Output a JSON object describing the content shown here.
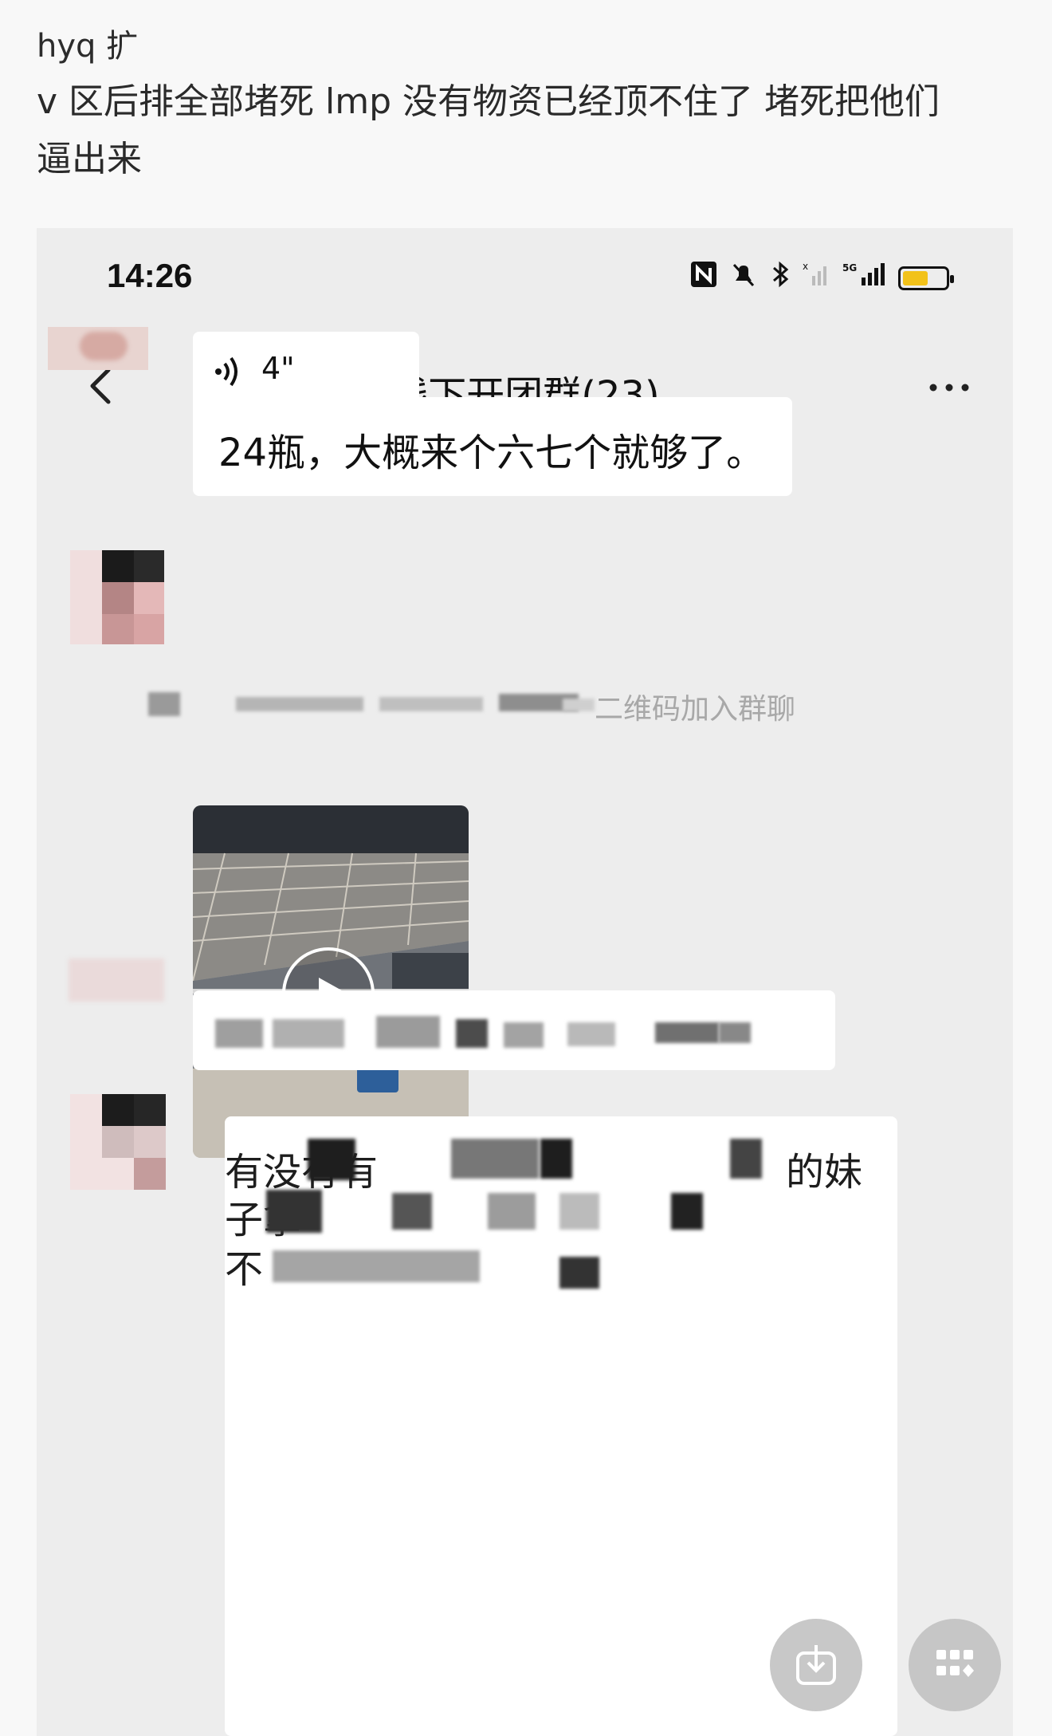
{
  "post": {
    "author": "hyq 扩",
    "text_line1": "v 区后排全部堵死  lmp 没有物资已经顶不住了  堵死把他们",
    "text_line2": "逼出来"
  },
  "phone": {
    "status_time": "14:26",
    "network_label": "5G",
    "battery_level": 0.6,
    "battery_color": "#f2c21a",
    "chat_title": "线下开团群(23)",
    "messages": {
      "voice_duration": "4\"",
      "text_1": "24瓶，大概来个六七个就够了。",
      "system_note": "二维码加入群聊",
      "reply_partial_line1_a": "有没有有",
      "reply_partial_line1_b": "的妹",
      "reply_partial_line2": "子拿",
      "reply_partial_line3": "不"
    }
  },
  "icons": {
    "back": "chevron-left-icon",
    "more": "more-dots-icon",
    "voice": "voice-wave-icon",
    "play": "play-icon",
    "download": "download-icon",
    "apps": "apps-grid-icon"
  }
}
